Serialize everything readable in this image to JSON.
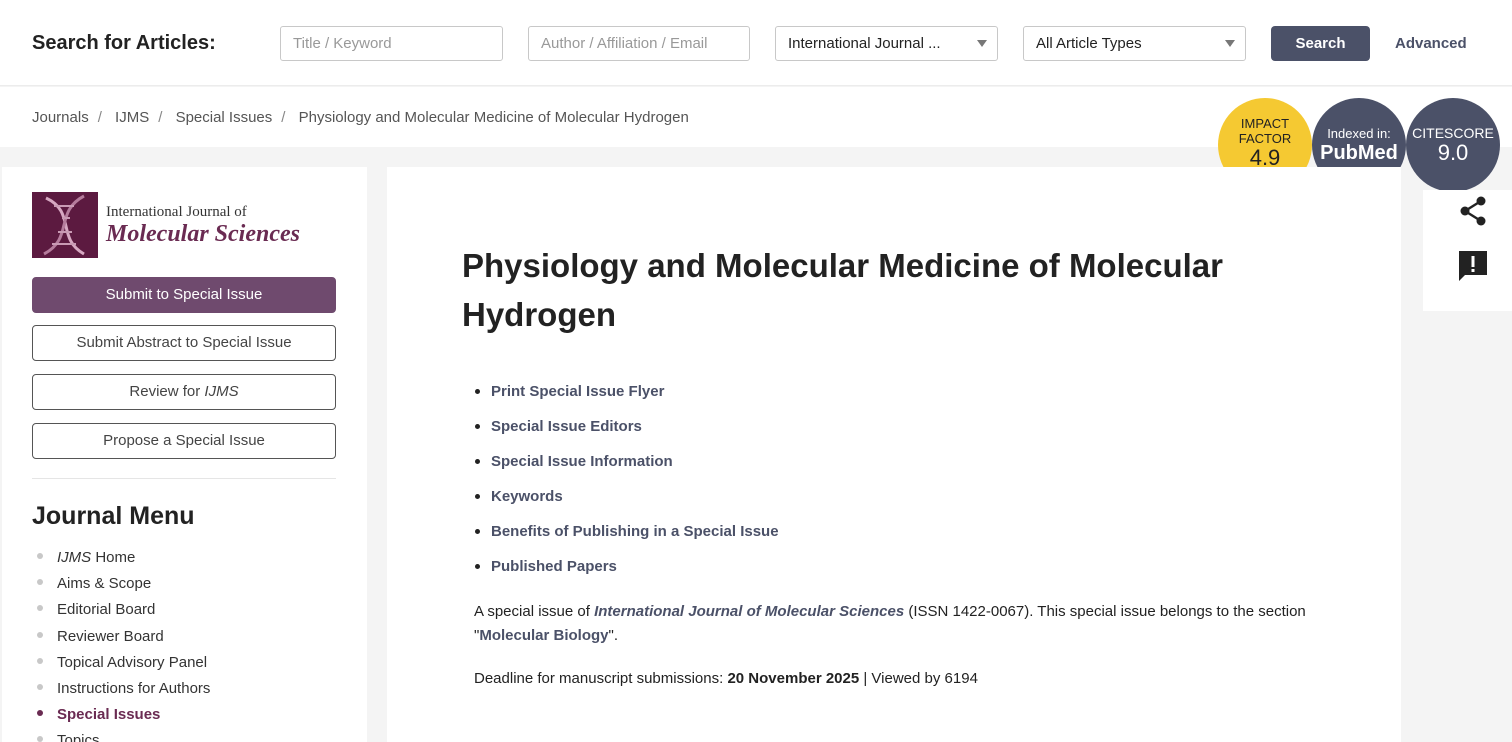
{
  "search": {
    "label": "Search for Articles:",
    "title_placeholder": "Title / Keyword",
    "author_placeholder": "Author / Affiliation / Email",
    "journal_selected": "International Journal ...",
    "type_selected": "All Article Types",
    "search_label": "Search",
    "advanced_label": "Advanced"
  },
  "breadcrumb": [
    "Journals",
    "IJMS",
    "Special Issues",
    "Physiology and Molecular Medicine of Molecular Hydrogen"
  ],
  "badges": {
    "impact": {
      "line1": "IMPACT",
      "line2": "FACTOR",
      "value": "4.9"
    },
    "indexed": {
      "line1": "Indexed in:",
      "value": "PubMed"
    },
    "citescore": {
      "line1": "CITESCORE",
      "value": "9.0"
    }
  },
  "logo": {
    "line1": "International Journal of",
    "line2": "Molecular Sciences"
  },
  "sidebar_buttons": {
    "submit": "Submit to Special Issue",
    "abstract": "Submit Abstract to Special Issue",
    "review_prefix": "Review for ",
    "review_journal": "IJMS",
    "propose": "Propose a Special Issue"
  },
  "journal_menu": {
    "title": "Journal Menu",
    "home_journal": "IJMS",
    "home_suffix": " Home",
    "items": [
      "Aims & Scope",
      "Editorial Board",
      "Reviewer Board",
      "Topical Advisory Panel",
      "Instructions for Authors",
      "Special Issues",
      "Topics"
    ]
  },
  "main": {
    "title": "Physiology and Molecular Medicine of Molecular Hydrogen",
    "links": [
      "Print Special Issue Flyer",
      "Special Issue Editors",
      "Special Issue Information",
      "Keywords",
      "Benefits of Publishing in a Special Issue",
      "Published Papers"
    ],
    "desc_prefix": "A special issue of ",
    "desc_journal": "International Journal of Molecular Sciences",
    "desc_mid": " (ISSN 1422-0067). This special issue belongs to the section \"",
    "desc_section": "Molecular Biology",
    "desc_suffix": "\".",
    "deadline_label": "Deadline for manuscript submissions: ",
    "deadline_date": "20 November 2025",
    "viewed": " | Viewed by 6194"
  },
  "icons": {
    "share": "share-icon",
    "report": "report-icon"
  },
  "colors": {
    "accent": "#4b5168",
    "brand": "#6f4a6e",
    "impact": "#f5c932"
  }
}
